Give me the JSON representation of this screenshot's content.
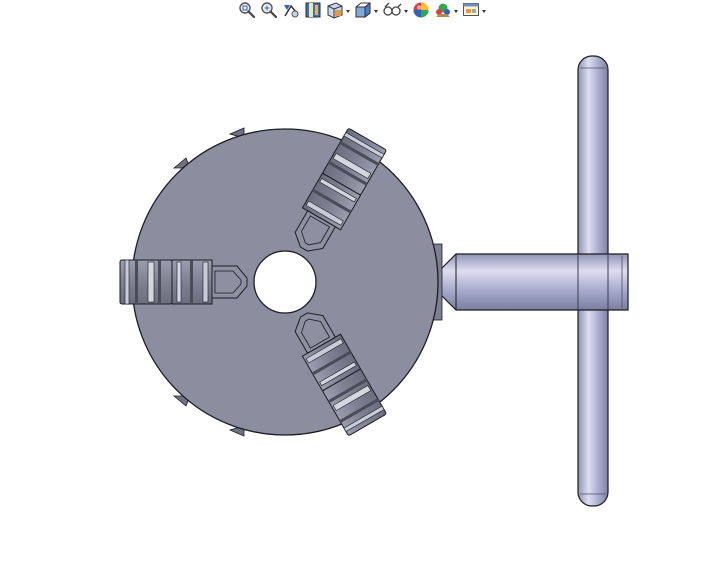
{
  "window": {
    "type": "3D CAD graphics area",
    "background_color": "#ffffff"
  },
  "toolbar": {
    "items": [
      {
        "name": "zoom-to-fit-icon",
        "has_dropdown": false
      },
      {
        "name": "zoom-to-area-icon",
        "has_dropdown": false
      },
      {
        "name": "previous-view-icon",
        "has_dropdown": false
      },
      {
        "name": "section-view-icon",
        "has_dropdown": false
      },
      {
        "name": "view-orientation-icon",
        "has_dropdown": true
      },
      {
        "name": "display-style-icon",
        "has_dropdown": true
      },
      {
        "name": "hide-show-items-icon",
        "has_dropdown": true
      },
      {
        "name": "edit-appearance-icon",
        "has_dropdown": false
      },
      {
        "name": "apply-scene-icon",
        "has_dropdown": true
      },
      {
        "name": "view-settings-icon",
        "has_dropdown": true
      }
    ]
  },
  "model": {
    "description_icon": "lathe-chuck-with-t-key",
    "colors": {
      "chuck_body": "#8a8e9e",
      "jaw_fill": "#8c90a0",
      "jaw_highlight": "#d4d6e0",
      "jaw_dark": "#4a4d58",
      "key_fill": "#a2a6c8",
      "key_highlight": "#dcdef0",
      "outline": "#1c1c22",
      "bore": "#ffffff"
    }
  }
}
